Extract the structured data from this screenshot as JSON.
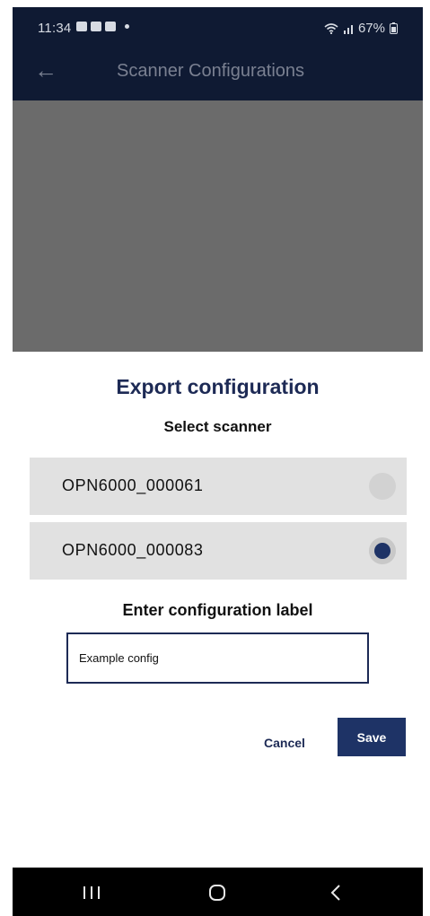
{
  "status_bar": {
    "time": "11:34",
    "battery": "67%"
  },
  "app_bar": {
    "title": "Scanner Configurations",
    "back_icon": "arrow-left-icon"
  },
  "dialog": {
    "title": "Export configuration",
    "select_label": "Select scanner",
    "scanners": [
      {
        "name": "OPN6000_000061",
        "selected": false
      },
      {
        "name": "OPN6000_000083",
        "selected": true
      }
    ],
    "label_heading": "Enter configuration label",
    "label_value": "Example config",
    "cancel_label": "Cancel",
    "save_label": "Save"
  },
  "colors": {
    "primary": "#1e3366",
    "title": "#1d2a55",
    "row_bg": "#e1e1e1",
    "overlay": "#6b6b6b"
  }
}
